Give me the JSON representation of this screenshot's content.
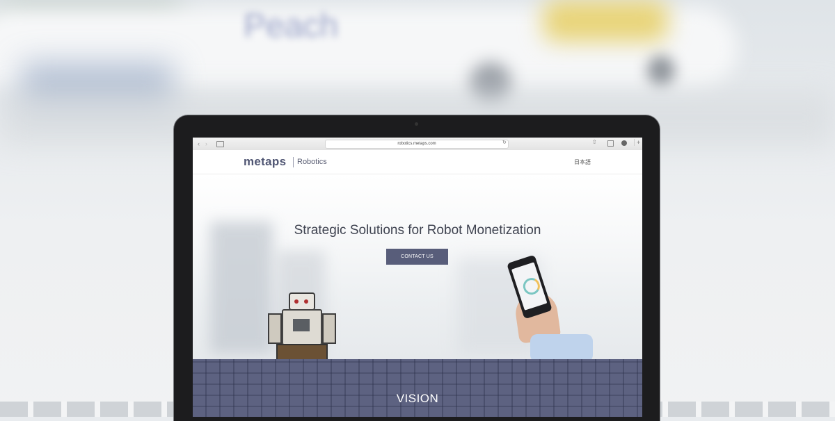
{
  "browser": {
    "url": "robotics.metaps.com",
    "nav_back": "‹",
    "nav_forward": "›",
    "reload": "↻",
    "share": "⇧",
    "new_tab": "+"
  },
  "site": {
    "logo": "metaps",
    "logo_sub": "Robotics",
    "language_link": "日本語"
  },
  "hero": {
    "headline": "Strategic Solutions for Robot Monetization",
    "cta_label": "CONTACT US"
  },
  "vision": {
    "title": "VISION"
  },
  "background": {
    "airplane_text": "Peach"
  },
  "colors": {
    "brand": "#505673",
    "button": "#585d7a",
    "vision_bg": "#5d6281"
  }
}
